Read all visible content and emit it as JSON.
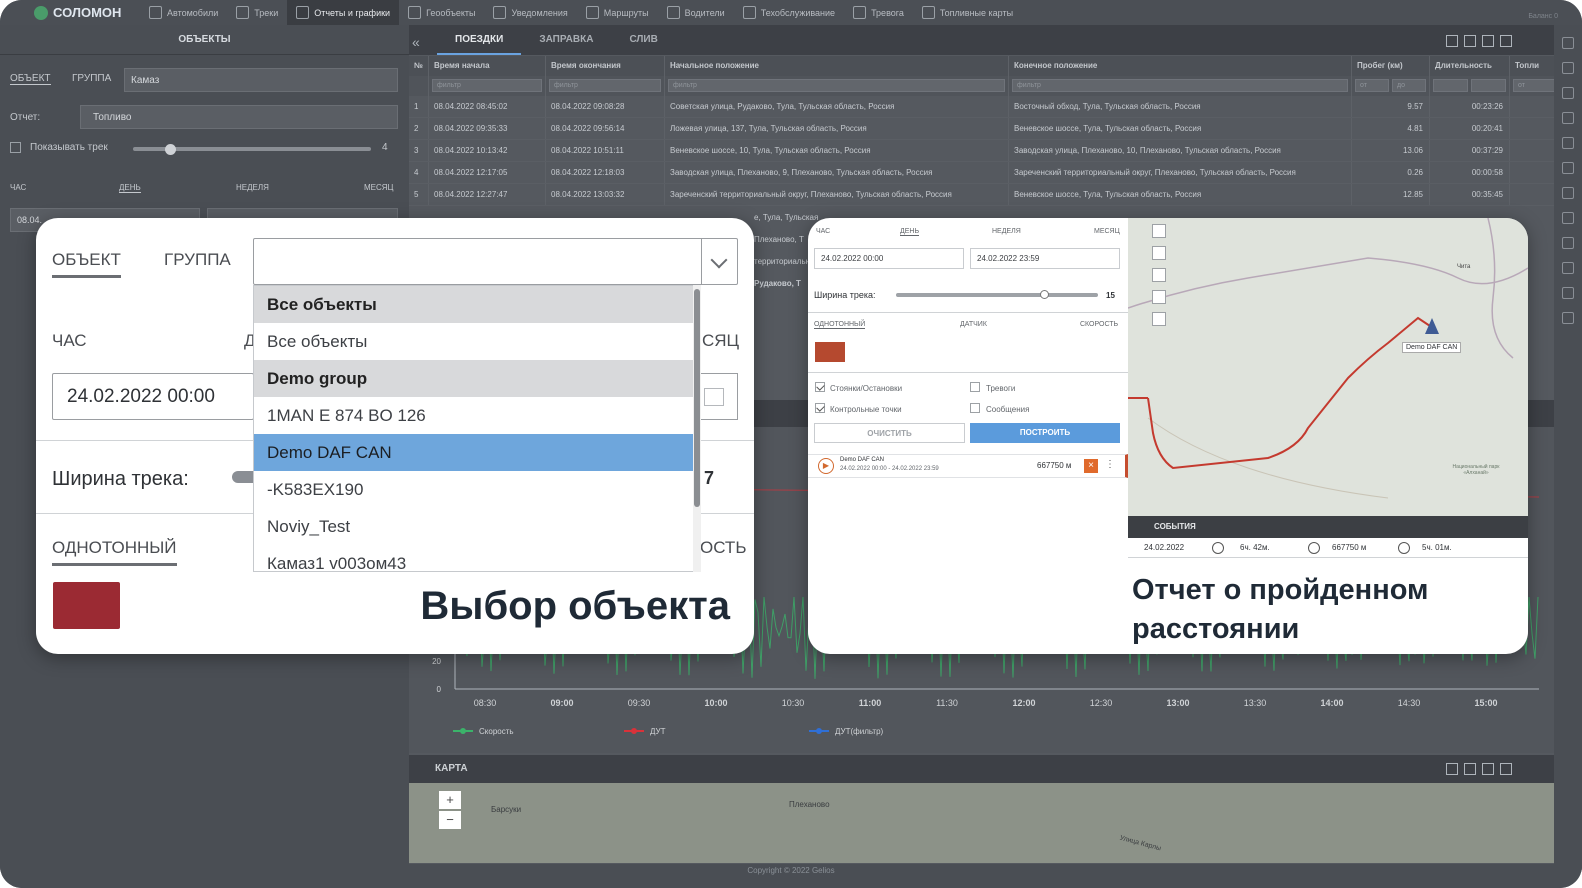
{
  "nav": {
    "logo": "СОЛОМОН",
    "items": [
      {
        "label": "Автомобили",
        "icon": "car-icon"
      },
      {
        "label": "Треки",
        "icon": "track-icon"
      },
      {
        "label": "Отчеты и графики",
        "icon": "chart-icon",
        "active": true
      },
      {
        "label": "Геообъекты",
        "icon": "geo-pin-icon"
      },
      {
        "label": "Уведомления",
        "icon": "bell-icon"
      },
      {
        "label": "Маршруты",
        "icon": "route-icon"
      },
      {
        "label": "Водители",
        "icon": "driver-icon"
      },
      {
        "label": "Техобслуживание",
        "icon": "wrench-icon"
      },
      {
        "label": "Тревога",
        "icon": "alarm-icon"
      },
      {
        "label": "Топливные карты",
        "icon": "fuel-card-icon"
      }
    ],
    "balance": "Баланс 0"
  },
  "sidepanel": {
    "title": "ОБЪЕКТЫ",
    "tab_object": "ОБЪЕКТ",
    "tab_group": "ГРУППА",
    "object_value": "Камаз",
    "report_label": "Отчет:",
    "report_value": "Топливо",
    "show_track_label": "Показывать трек",
    "track_width": "4",
    "period_hour": "ЧАС",
    "period_day": "ДЕНЬ",
    "period_week": "НЕДЕЛЯ",
    "period_month": "МЕСЯЦ",
    "date_partial": "08.04."
  },
  "main": {
    "tabs": [
      "ПОЕЗДКИ",
      "ЗАПРАВКА",
      "СЛИВ"
    ],
    "columns": [
      "№",
      "Время начала",
      "Время окончания",
      "Начальное положение",
      "Конечное положение",
      "Пробег (км)",
      "Длительность",
      "Топли"
    ],
    "filter_placeholder": "фильтр",
    "filter_from": "от",
    "filter_to": "до",
    "rows": [
      {
        "n": "1",
        "start": "08.04.2022 08:45:02",
        "end": "08.04.2022 09:08:28",
        "from": "Советская улица, Рудаково, Тула, Тульская область, Россия",
        "to": "Восточный обход, Тула, Тульская область, Россия",
        "km": "9.57",
        "dur": "00:23:26"
      },
      {
        "n": "2",
        "start": "08.04.2022 09:35:33",
        "end": "08.04.2022 09:56:14",
        "from": "Ложевая улица, 137, Тула, Тульская область, Россия",
        "to": "Веневское шоссе, Тула, Тульская область, Россия",
        "km": "4.81",
        "dur": "00:20:41"
      },
      {
        "n": "3",
        "start": "08.04.2022 10:13:42",
        "end": "08.04.2022 10:51:11",
        "from": "Веневское шоссе, 10, Тула, Тульская область, Россия",
        "to": "Заводская улица, Плеханово, 10, Плеханово, Тульская область, Россия",
        "km": "13.06",
        "dur": "00:37:29"
      },
      {
        "n": "4",
        "start": "08.04.2022 12:17:05",
        "end": "08.04.2022 12:18:03",
        "from": "Заводская улица, Плеханово, 9, Плеханово, Тульская область, Россия",
        "to": "Зареченский территориальный округ, Плеханово, Тульская область, Россия",
        "km": "0.26",
        "dur": "00:00:58"
      },
      {
        "n": "5",
        "start": "08.04.2022 12:27:47",
        "end": "08.04.2022 13:03:32",
        "from": "Зареченский территориальный округ, Плеханово, Тульская область, Россия",
        "to": "Веневское шоссе, Тула, Тульская область, Россия",
        "km": "12.85",
        "dur": "00:35:45"
      }
    ],
    "partial_rows": [
      "е, Тула, Тульская",
      "Плеханово, Т",
      "территориальный",
      "Рудаково, Т"
    ]
  },
  "chart": {
    "ytick": [
      "20",
      "0"
    ],
    "xticks": [
      "08:30",
      "09:00",
      "09:30",
      "10:00",
      "10:30",
      "11:00",
      "11:30",
      "12:00",
      "12:30",
      "13:00",
      "13:30",
      "14:00",
      "14:30",
      "15:00"
    ],
    "legend": [
      {
        "name": "Скорость",
        "color": "#3bb36a"
      },
      {
        "name": "ДУТ",
        "color": "#d9323a"
      },
      {
        "name": "ДУТ(фильтр)",
        "color": "#2f6fd6"
      }
    ]
  },
  "map": {
    "title": "КАРТА",
    "labels": [
      "Барсуки",
      "Плеханово",
      "Улица Карлы"
    ],
    "zoom_in": "+",
    "zoom_out": "−"
  },
  "footer": "Copyright © 2022 Gelios",
  "card1": {
    "tab_object": "ОБЪЕКТ",
    "tab_group": "ГРУППА",
    "select_value": "",
    "options": [
      {
        "label": "Все объекты",
        "type": "group"
      },
      {
        "label": "Все объекты",
        "type": "item"
      },
      {
        "label": "Demo group",
        "type": "group"
      },
      {
        "label": "1MAN E 874 BO 126",
        "type": "item"
      },
      {
        "label": "Demo DAF CAN",
        "type": "selected"
      },
      {
        "label": "-K583EX190",
        "type": "item"
      },
      {
        "label": "Noviy_Test",
        "type": "item"
      },
      {
        "label": "Камаз1 v003ом43",
        "type": "item"
      }
    ],
    "hour_label": "ЧАС",
    "day_initial": "Д",
    "month_partial": "СЯЦ",
    "date_value": "24.02.2022 00:00",
    "track_width_label": "Ширина трека:",
    "track_width_partial": "7",
    "mono_label": "ОДНОТОННЫЙ",
    "speed_partial": "ОСТЬ",
    "color": "#9b2a33",
    "caption": "Выбор объекта"
  },
  "card2": {
    "period_hour": "ЧАС",
    "period_day": "ДЕНЬ",
    "period_week": "НЕДЕЛЯ",
    "period_month": "МЕСЯЦ",
    "date_from": "24.02.2022 00:00",
    "date_to": "24.02.2022 23:59",
    "track_width_label": "Ширина трека:",
    "track_width": "15",
    "mode_mono": "ОДНОТОННЫЙ",
    "mode_sensor": "ДАТЧИК",
    "mode_speed": "СКОРОСТЬ",
    "color": "#b5492f",
    "check_stops": "Стоянки/Остановки",
    "check_alarms": "Тревоги",
    "check_points": "Контрольные точки",
    "check_messages": "Сообщения",
    "btn_clear": "ОЧИСТИТЬ",
    "btn_build": "ПОСТРОИТЬ",
    "track_item_name": "Demo DAF CAN",
    "track_item_period": "24.02.2022 00:00 - 24.02.2022 23:59",
    "track_item_distance": "667750 м",
    "map_marker": "Demo DAF CAN",
    "map_label_park": "Национальный парк «Алханай»",
    "map_label_city": "Чита",
    "events_title": "СОБЫТИЯ",
    "event_date": "24.02.2022",
    "event_time": "6ч. 42м.",
    "event_distance": "667750 м",
    "event_parking": "5ч. 01м.",
    "caption": "Отчет о пройденном расстоянии"
  }
}
